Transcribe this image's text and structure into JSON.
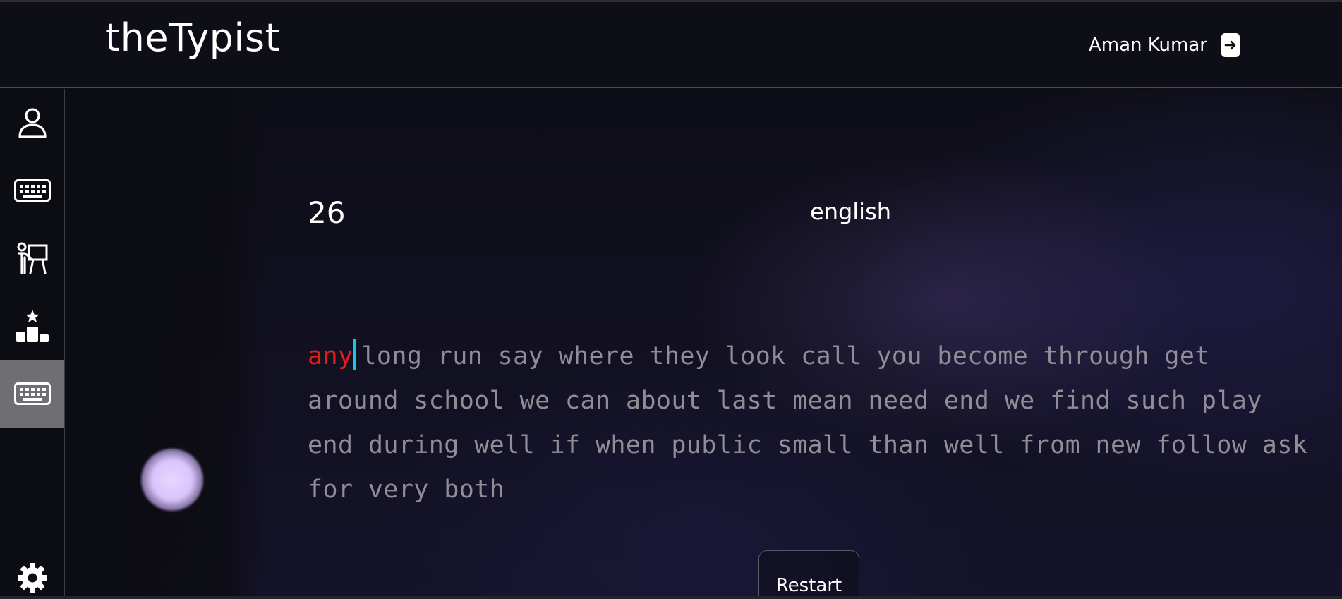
{
  "header": {
    "logo": "theTypist",
    "user_name": "Aman Kumar",
    "logout_icon": "logout-icon"
  },
  "sidebar": {
    "items": [
      {
        "icon": "user-icon",
        "active": false
      },
      {
        "icon": "keyboard-icon",
        "active": false
      },
      {
        "icon": "teacher-board-icon",
        "active": false
      },
      {
        "icon": "leaderboard-podium-icon",
        "active": false
      },
      {
        "icon": "keyboard-icon",
        "active": true
      }
    ],
    "settings_icon": "gear-icon"
  },
  "test": {
    "timer": "26",
    "language": "english",
    "typed_word": "any",
    "remaining_text": "long run say where they look call you become through get around school we can about last mean need end we find such play end during well if when public small than well from new follow ask for very both",
    "restart_label": "Restart"
  },
  "colors": {
    "typed_error": "#e11d1d",
    "caret": "#19c4e6",
    "untyped": "#8f8e96",
    "active_sidebar": "#6f6f73"
  }
}
